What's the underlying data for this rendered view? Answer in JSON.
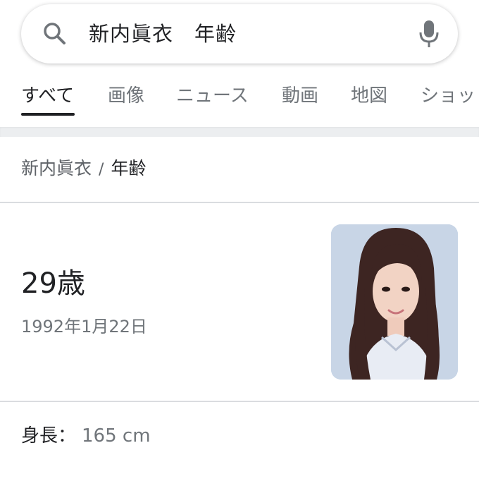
{
  "search": {
    "query": "新内眞衣　年齢",
    "search_icon": "search-icon",
    "mic_icon": "mic-icon"
  },
  "tabs": [
    {
      "label": "すべて",
      "active": true
    },
    {
      "label": "画像"
    },
    {
      "label": "ニュース"
    },
    {
      "label": "動画"
    },
    {
      "label": "地図"
    },
    {
      "label": "ショッ"
    }
  ],
  "breadcrumb": {
    "parent": "新内眞衣",
    "separator": "/",
    "current": "年齢"
  },
  "answer": {
    "main": "29歳",
    "sub": "1992年1月22日"
  },
  "facts": [
    {
      "label": "身長：",
      "value": "165 cm"
    }
  ],
  "colors": {
    "text_primary": "#202124",
    "text_secondary": "#70757a",
    "divider": "#dadce0",
    "mic_gray": "#70757a"
  }
}
